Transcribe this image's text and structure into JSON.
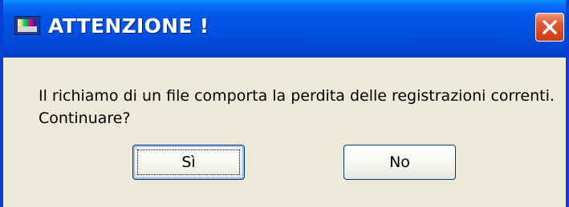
{
  "dialog": {
    "title": "ATTENZIONE !",
    "message_line1": "Il richiamo di un file comporta la perdita delle registrazioni correnti.",
    "message_line2": "Continuare?",
    "icons": {
      "app": "tv-test-pattern-icon",
      "close": "close-icon"
    },
    "buttons": {
      "yes_label": "Sì",
      "no_label": "No"
    },
    "colors": {
      "titlebar": "#0050e0",
      "border": "#0a3fd4",
      "close": "#e0562c",
      "body": "#ece9d8"
    }
  }
}
